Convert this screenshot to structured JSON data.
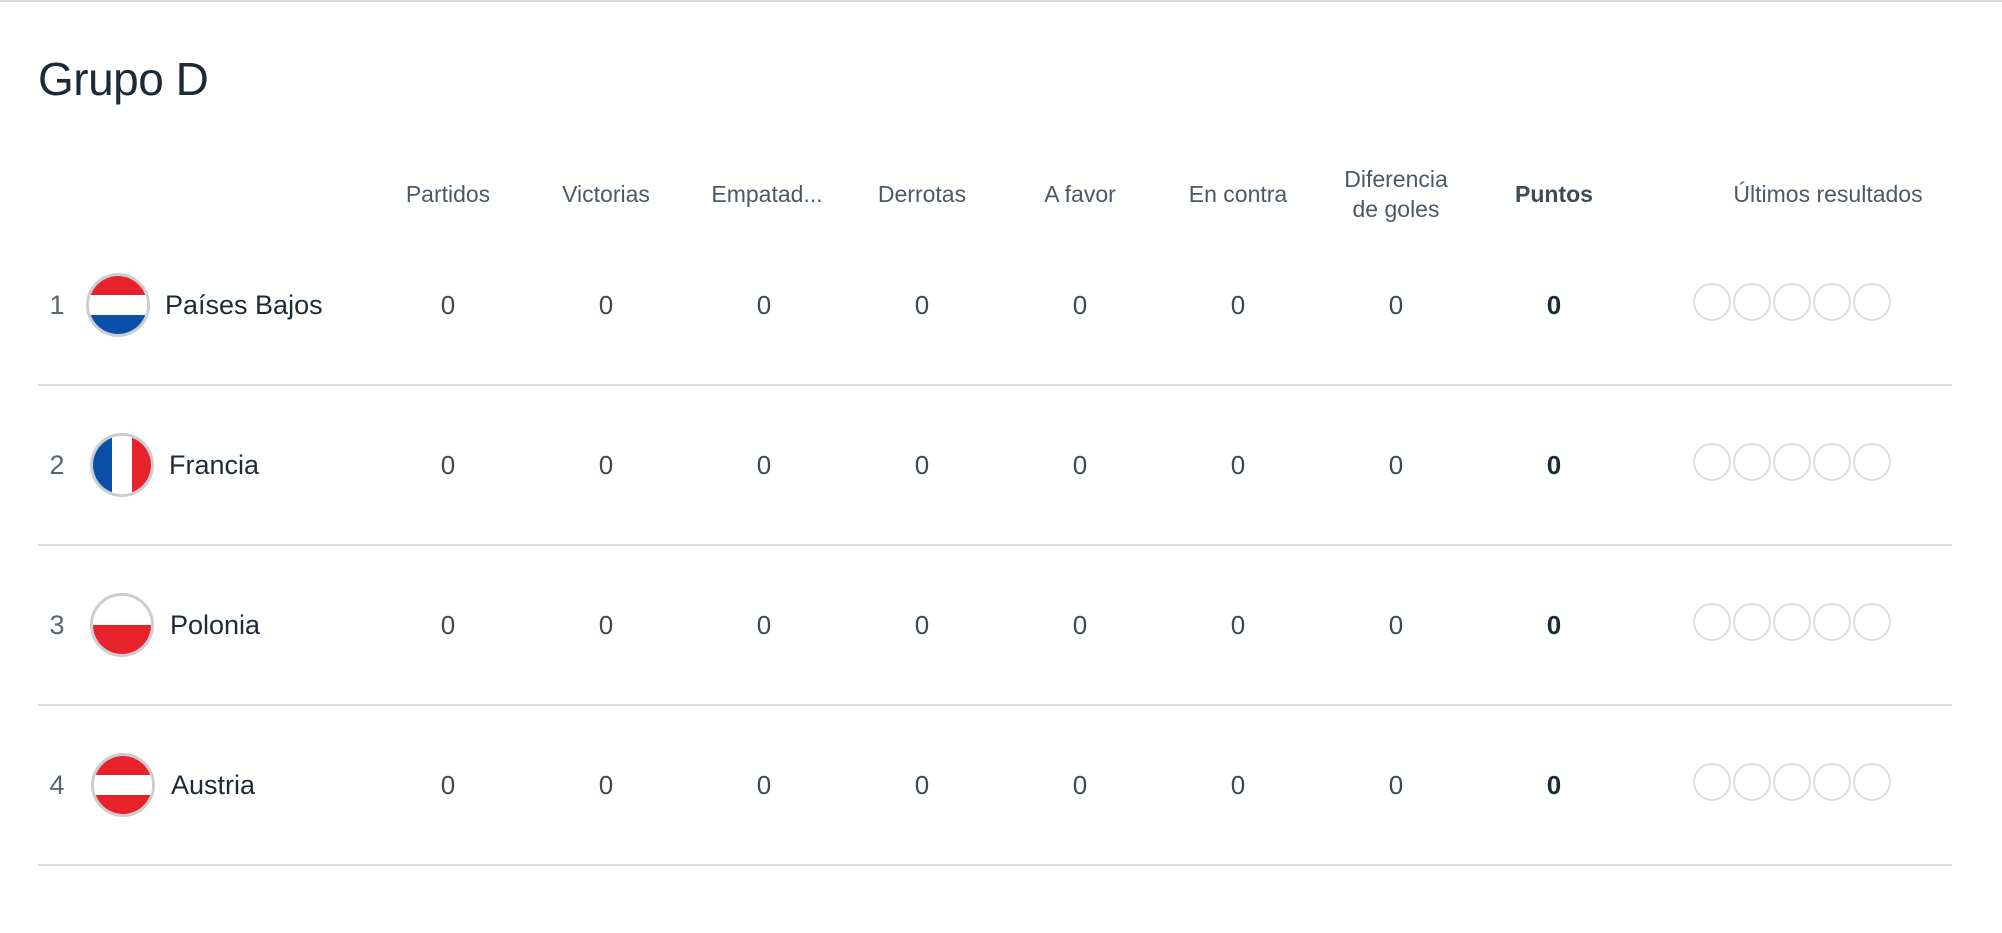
{
  "group": {
    "title": "Grupo D"
  },
  "columns": {
    "played": "Partidos",
    "wins": "Victorias",
    "draws": "Empatad...",
    "losses": "Derrotas",
    "goals_for": "A favor",
    "goals_against": "En contra",
    "goal_difference": "Diferencia de goles",
    "points": "Puntos",
    "last_results": "Últimos resultados"
  },
  "teams": [
    {
      "position": "1",
      "name": "Países Bajos",
      "flag": "netherlands-flag-icon",
      "played": "0",
      "wins": "0",
      "draws": "0",
      "losses": "0",
      "goals_for": "0",
      "goals_against": "0",
      "goal_difference": "0",
      "points": "0"
    },
    {
      "position": "2",
      "name": "Francia",
      "flag": "france-flag-icon",
      "played": "0",
      "wins": "0",
      "draws": "0",
      "losses": "0",
      "goals_for": "0",
      "goals_against": "0",
      "goal_difference": "0",
      "points": "0"
    },
    {
      "position": "3",
      "name": "Polonia",
      "flag": "poland-flag-icon",
      "played": "0",
      "wins": "0",
      "draws": "0",
      "losses": "0",
      "goals_for": "0",
      "goals_against": "0",
      "goal_difference": "0",
      "points": "0"
    },
    {
      "position": "4",
      "name": "Austria",
      "flag": "austria-flag-icon",
      "played": "0",
      "wins": "0",
      "draws": "0",
      "losses": "0",
      "goals_for": "0",
      "goals_against": "0",
      "goal_difference": "0",
      "points": "0"
    }
  ],
  "colors": {
    "netherlands": [
      "#e8222a",
      "#ffffff",
      "#0a4fa8"
    ],
    "france": [
      "#0a4fa8",
      "#ffffff",
      "#e8222a"
    ],
    "poland": [
      "#ffffff",
      "#e8222a"
    ],
    "austria": [
      "#e8222a",
      "#ffffff",
      "#e8222a"
    ]
  }
}
